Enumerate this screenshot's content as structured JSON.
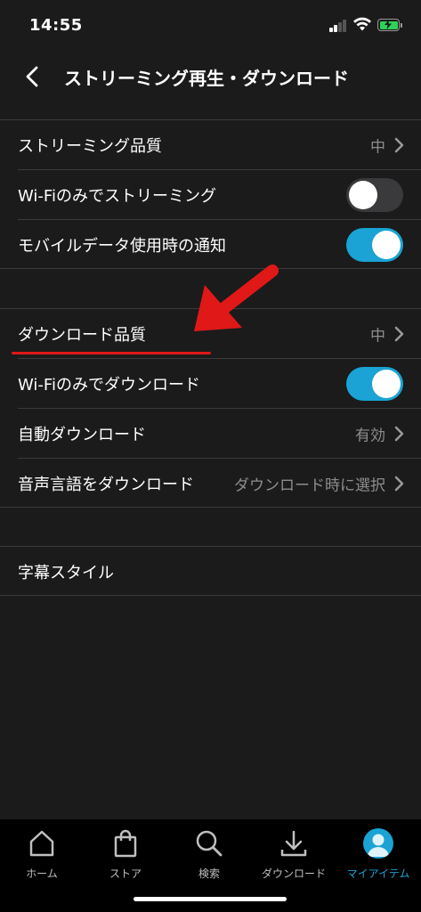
{
  "status_bar": {
    "time": "14:55"
  },
  "header": {
    "title": "ストリーミング再生・ダウンロード"
  },
  "streaming": {
    "quality_label": "ストリーミング品質",
    "quality_value": "中",
    "wifi_only_label": "Wi-Fiのみでストリーミング",
    "wifi_only_on": false,
    "mobile_data_notify_label": "モバイルデータ使用時の通知",
    "mobile_data_notify_on": true
  },
  "download": {
    "quality_label": "ダウンロード品質",
    "quality_value": "中",
    "wifi_only_label": "Wi-Fiのみでダウンロード",
    "wifi_only_on": true,
    "auto_label": "自動ダウンロード",
    "auto_value": "有効",
    "audio_language_label": "音声言語をダウンロード",
    "audio_language_value": "ダウンロード時に選択"
  },
  "subtitles": {
    "style_label": "字幕スタイル"
  },
  "tab_bar": {
    "home": "ホーム",
    "store": "ストア",
    "search": "検索",
    "downloads": "ダウンロード",
    "my_items": "マイアイテム",
    "active": "my_items"
  },
  "colors": {
    "accent": "#1aa3d4",
    "annotation": "#e01818",
    "background": "#1b1b1b"
  },
  "icons": [
    "back-chevron-icon",
    "chevron-right-icon",
    "home-icon",
    "shopping-bag-icon",
    "search-icon",
    "download-icon",
    "avatar-icon",
    "wifi-icon",
    "battery-charging-icon",
    "signal-icon"
  ]
}
